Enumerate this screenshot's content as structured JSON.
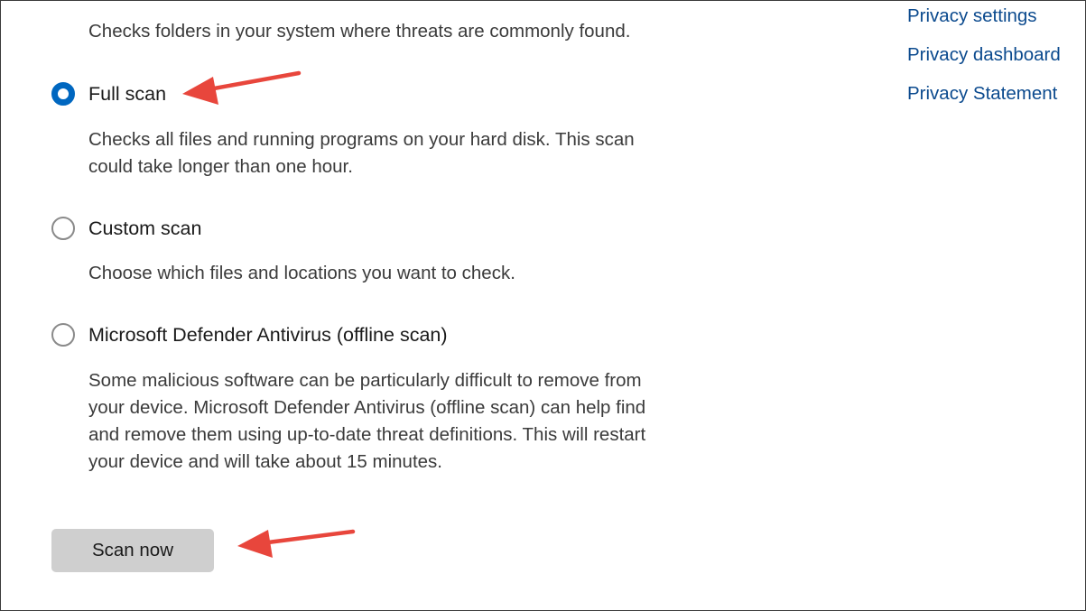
{
  "scan_options": {
    "quick_desc": "Checks folders in your system where threats are commonly found.",
    "full": {
      "label": "Full scan",
      "desc": "Checks all files and running programs on your hard disk. This scan\ncould take longer than one hour.",
      "selected": true
    },
    "custom": {
      "label": "Custom scan",
      "desc": "Choose which files and locations you want to check.",
      "selected": false
    },
    "offline": {
      "label": "Microsoft Defender Antivirus (offline scan)",
      "desc": "Some malicious software can be particularly difficult to remove from\nyour device. Microsoft Defender Antivirus (offline scan) can help find\nand remove them using up-to-date threat definitions. This will restart\nyour device and will take about 15 minutes.",
      "selected": false
    }
  },
  "sidebar": {
    "links": [
      {
        "label": "Privacy settings"
      },
      {
        "label": "Privacy dashboard"
      },
      {
        "label": "Privacy Statement"
      }
    ]
  },
  "actions": {
    "scan_now_label": "Scan now"
  },
  "colors": {
    "accent": "#0067c0",
    "link": "#0b4a8e",
    "annotation_arrow": "#e8463c",
    "button_bg": "#cfcfcf"
  },
  "annotations": {
    "arrow_icon": "arrow-left-icon"
  }
}
